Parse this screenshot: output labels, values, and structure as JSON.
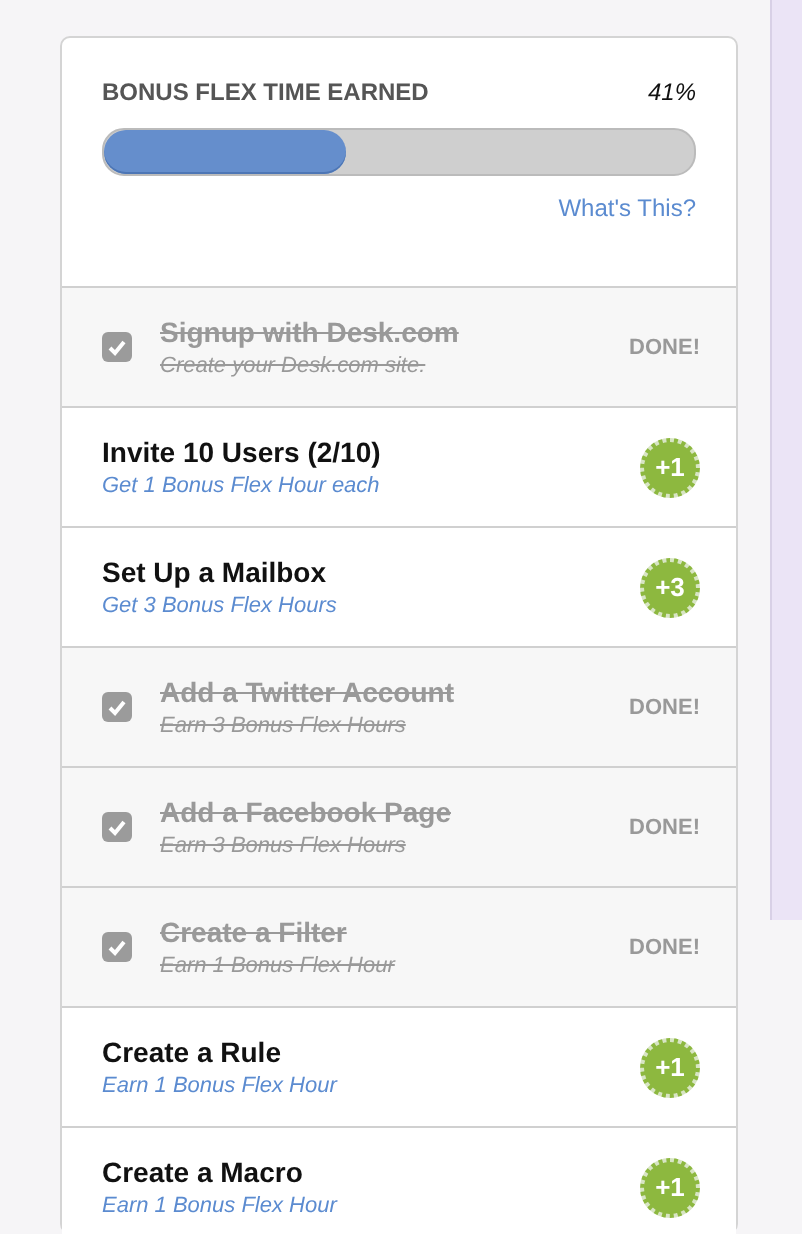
{
  "progress": {
    "title": "BONUS FLEX TIME EARNED",
    "percent": "41%",
    "level": 0.41,
    "link": "What's This?"
  },
  "tasks": [
    {
      "kind": "done",
      "checked": true,
      "title": "Signup with Desk.com",
      "subtitle": "Create your Desk.com site.",
      "status": "DONE!"
    },
    {
      "kind": "bonus",
      "checked": false,
      "title": "Invite 10 Users (2/10)",
      "subtitle": "Get 1 Bonus Flex Hour each",
      "badge": "+1"
    },
    {
      "kind": "bonus",
      "checked": false,
      "title": "Set Up a Mailbox",
      "subtitle": "Get 3 Bonus Flex Hours",
      "badge": "+3"
    },
    {
      "kind": "done",
      "checked": true,
      "title": "Add a Twitter Account",
      "subtitle": "Earn 3 Bonus Flex Hours",
      "status": "DONE!"
    },
    {
      "kind": "done",
      "checked": true,
      "title": "Add a Facebook Page",
      "subtitle": "Earn 3 Bonus Flex Hours",
      "status": "DONE!"
    },
    {
      "kind": "done",
      "checked": true,
      "title": "Create a Filter",
      "subtitle": "Earn 1 Bonus Flex Hour",
      "status": "DONE!"
    },
    {
      "kind": "bonus",
      "checked": false,
      "title": "Create a Rule",
      "subtitle": "Earn 1 Bonus Flex Hour",
      "badge": "+1"
    },
    {
      "kind": "bonus",
      "checked": false,
      "title": "Create a Macro",
      "subtitle": "Earn 1 Bonus Flex Hour",
      "badge": "+1"
    }
  ]
}
